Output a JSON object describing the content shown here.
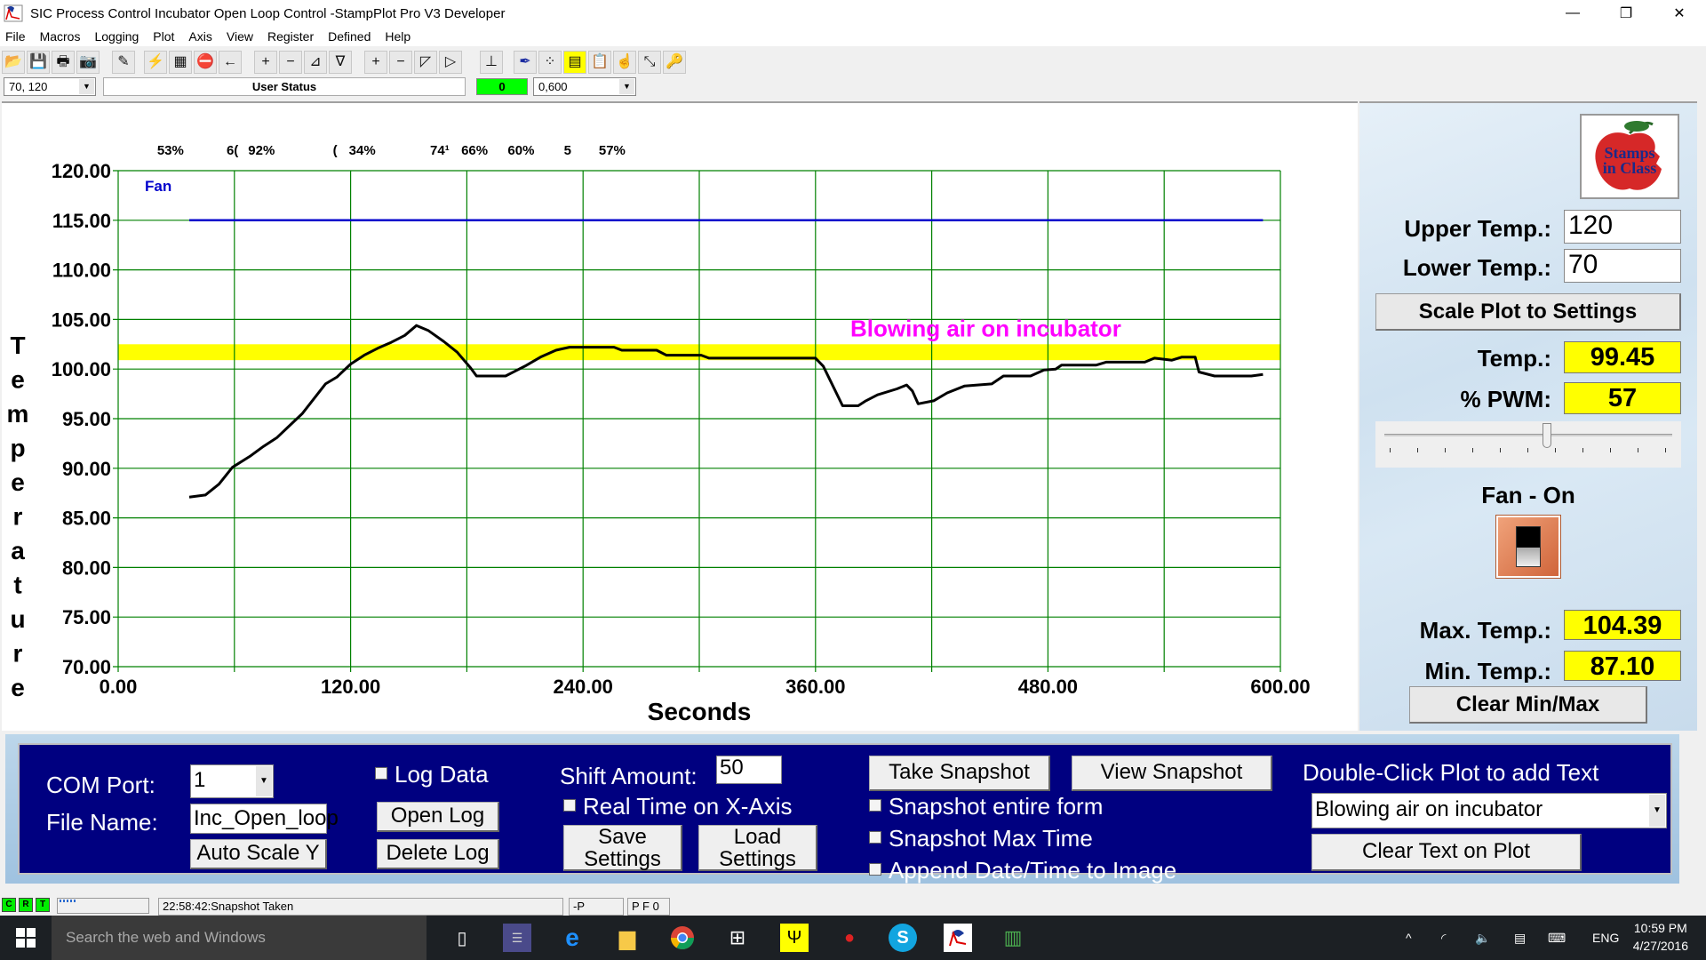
{
  "window": {
    "title": "SIC Process Control Incubator Open Loop Control -StampPlot Pro V3 Developer",
    "controls": [
      "—",
      "❐",
      "✕"
    ]
  },
  "menu": [
    "File",
    "Macros",
    "Logging",
    "Plot",
    "Axis",
    "View",
    "Register",
    "Defined",
    "Help"
  ],
  "toolbar": {
    "icons": [
      {
        "name": "open-folder-icon",
        "glyph": "📂"
      },
      {
        "name": "save-icon",
        "glyph": "💾"
      },
      {
        "name": "print-icon",
        "glyph": "🖶"
      },
      {
        "name": "camera-icon",
        "glyph": "📷"
      },
      {
        "name": "eraser-icon",
        "glyph": "✎"
      },
      {
        "name": "connect-icon",
        "glyph": "⚡"
      },
      {
        "name": "chip-icon",
        "glyph": "▦"
      },
      {
        "name": "stop-icon",
        "glyph": "⛔"
      },
      {
        "name": "arrow-left-icon",
        "glyph": "←"
      },
      {
        "name": "y-zoom-in-icon",
        "glyph": "+"
      },
      {
        "name": "y-zoom-out-icon",
        "glyph": "−"
      },
      {
        "name": "y-shift-up-icon",
        "glyph": "⊿"
      },
      {
        "name": "y-shift-down-icon",
        "glyph": "∇"
      },
      {
        "name": "x-zoom-in-icon",
        "glyph": "+"
      },
      {
        "name": "x-zoom-out-icon",
        "glyph": "−"
      },
      {
        "name": "x-shift-left-icon",
        "glyph": "◸"
      },
      {
        "name": "x-shift-right-icon",
        "glyph": "▷"
      },
      {
        "name": "plot-axis-icon",
        "glyph": "⊥"
      },
      {
        "name": "pen-icon",
        "glyph": "✒"
      },
      {
        "name": "points-icon",
        "glyph": "⁘"
      },
      {
        "name": "note-icon",
        "glyph": "▤"
      },
      {
        "name": "clipboard-icon",
        "glyph": "📋"
      },
      {
        "name": "pointer-icon",
        "glyph": "☝"
      },
      {
        "name": "resize-icon",
        "glyph": "⤡"
      },
      {
        "name": "key-icon",
        "glyph": "🔑"
      }
    ]
  },
  "statusrow": {
    "y_range": "70, 120",
    "user_status": "User Status",
    "counter": "0",
    "x_range": "0,600"
  },
  "chart_data": {
    "type": "line",
    "title": "",
    "xlabel": "Seconds",
    "ylabel": "Temperature",
    "xlim": [
      0,
      600
    ],
    "ylim": [
      70,
      120
    ],
    "x_ticks": [
      "0.00",
      "120.00",
      "240.00",
      "360.00",
      "480.00",
      "600.00"
    ],
    "y_ticks": [
      "120.00",
      "115.00",
      "110.00",
      "105.00",
      "100.00",
      "95.00",
      "90.00",
      "85.00",
      "80.00",
      "75.00",
      "70.00"
    ],
    "x_grid_step": 60,
    "y_grid_step": 5,
    "grid": true,
    "grid_color": "#008000",
    "band": {
      "from": 100.9,
      "to": 102.5,
      "color": "#ffff00"
    },
    "series": [
      {
        "name": "Temperature",
        "color": "#000000",
        "points": [
          [
            36.7,
            87.1
          ],
          [
            45,
            87.3
          ],
          [
            52,
            88.4
          ],
          [
            59,
            90.1
          ],
          [
            68,
            91.2
          ],
          [
            75,
            92.2
          ],
          [
            82,
            93.1
          ],
          [
            88,
            94.2
          ],
          [
            95,
            95.5
          ],
          [
            101,
            97.0
          ],
          [
            107,
            98.5
          ],
          [
            113,
            99.2
          ],
          [
            120,
            100.5
          ],
          [
            127,
            101.4
          ],
          [
            134,
            102.1
          ],
          [
            141,
            102.7
          ],
          [
            148,
            103.4
          ],
          [
            154,
            104.39
          ],
          [
            160,
            103.9
          ],
          [
            168,
            102.8
          ],
          [
            175,
            101.7
          ],
          [
            182,
            100.1
          ],
          [
            185,
            99.3
          ],
          [
            200,
            99.3
          ],
          [
            205,
            99.8
          ],
          [
            210,
            100.3
          ],
          [
            218,
            101.2
          ],
          [
            226,
            101.9
          ],
          [
            233,
            102.2
          ],
          [
            256,
            102.2
          ],
          [
            260,
            101.9
          ],
          [
            278,
            101.9
          ],
          [
            283,
            101.4
          ],
          [
            301,
            101.4
          ],
          [
            305,
            101.1
          ],
          [
            360,
            101.1
          ],
          [
            364,
            100.3
          ],
          [
            368,
            98.7
          ],
          [
            374,
            96.3
          ],
          [
            382,
            96.3
          ],
          [
            386,
            96.8
          ],
          [
            392,
            97.4
          ],
          [
            402,
            98.0
          ],
          [
            407,
            98.4
          ],
          [
            410,
            97.8
          ],
          [
            413,
            96.5
          ],
          [
            421,
            96.8
          ],
          [
            428,
            97.6
          ],
          [
            437,
            98.3
          ],
          [
            451,
            98.5
          ],
          [
            457,
            99.3
          ],
          [
            471,
            99.3
          ],
          [
            478,
            99.9
          ],
          [
            484,
            100.0
          ],
          [
            487,
            100.4
          ],
          [
            505,
            100.4
          ],
          [
            510,
            100.7
          ],
          [
            530,
            100.7
          ],
          [
            535,
            101.1
          ],
          [
            544,
            100.9
          ],
          [
            549,
            101.2
          ],
          [
            556,
            101.2
          ],
          [
            558,
            99.7
          ],
          [
            566,
            99.3
          ],
          [
            585,
            99.3
          ],
          [
            591,
            99.45
          ]
        ]
      },
      {
        "name": "Fan",
        "color": "#0000cc",
        "points": [
          [
            36.7,
            115
          ],
          [
            591,
            115
          ]
        ]
      }
    ],
    "legend": {
      "text": "Fan",
      "position": "top-left",
      "color": "#0000cc"
    },
    "top_labels": [
      {
        "x": 27,
        "text": "53%"
      },
      {
        "x": 59,
        "text": "6("
      },
      {
        "x": 74,
        "text": "92%"
      },
      {
        "x": 112,
        "text": "("
      },
      {
        "x": 126,
        "text": "34%"
      },
      {
        "x": 166,
        "text": "74¹"
      },
      {
        "x": 184,
        "text": "66%"
      },
      {
        "x": 208,
        "text": "60%"
      },
      {
        "x": 232,
        "text": "5"
      },
      {
        "x": 255,
        "text": "57%"
      }
    ],
    "annotation": {
      "text": "Blowing air on incubator",
      "x": 378,
      "y": 103.3,
      "color": "#ff00ff"
    }
  },
  "right_panel": {
    "logo_text": [
      "Stamps",
      "in Class"
    ],
    "upper_temp_label": "Upper Temp.:",
    "upper_temp_value": "120",
    "lower_temp_label": "Lower Temp.:",
    "lower_temp_value": "70",
    "scale_button": "Scale Plot to Settings",
    "temp_label": "Temp.:",
    "temp_value": "99.45",
    "pwm_label": "% PWM:",
    "pwm_value": "57",
    "pwm_slider_fraction": 0.57,
    "fan_label": "Fan - On",
    "max_label": "Max. Temp.:",
    "max_value": "104.39",
    "min_label": "Min. Temp.:",
    "min_value": "87.10",
    "clear_button": "Clear Min/Max"
  },
  "bottom_panel": {
    "com_port_label": "COM Port:",
    "com_port_value": "1",
    "file_name_label": "File Name:",
    "file_name_value": "Inc_Open_loop",
    "auto_scale_button": "Auto Scale Y",
    "log_data_label": "Log Data",
    "open_log_button": "Open Log",
    "delete_log_button": "Delete Log",
    "shift_amount_label": "Shift Amount:",
    "shift_amount_value": "50",
    "real_time_label": "Real Time on X-Axis",
    "save_settings_button": [
      "Save",
      "Settings"
    ],
    "load_settings_button": [
      "Load",
      "Settings"
    ],
    "take_snapshot_button": "Take Snapshot",
    "view_snapshot_button": "View Snapshot",
    "snapshot_entire_label": "Snapshot entire form",
    "snapshot_max_label": "Snapshot Max Time",
    "append_date_label": "Append Date/Time to Image",
    "double_click_label": "Double-Click Plot to add Text",
    "text_select_value": "Blowing air on incubator",
    "clear_text_button": "Clear Text on Plot"
  },
  "statusbar": {
    "leds": [
      "C",
      "R",
      "T"
    ],
    "message": "22:58:42:Snapshot Taken",
    "panel2": "-P",
    "panel3": "P F 0"
  },
  "taskbar": {
    "search_placeholder": "Search the web and Windows",
    "language": "ENG",
    "time": "10:59 PM",
    "date": "4/27/2016"
  }
}
